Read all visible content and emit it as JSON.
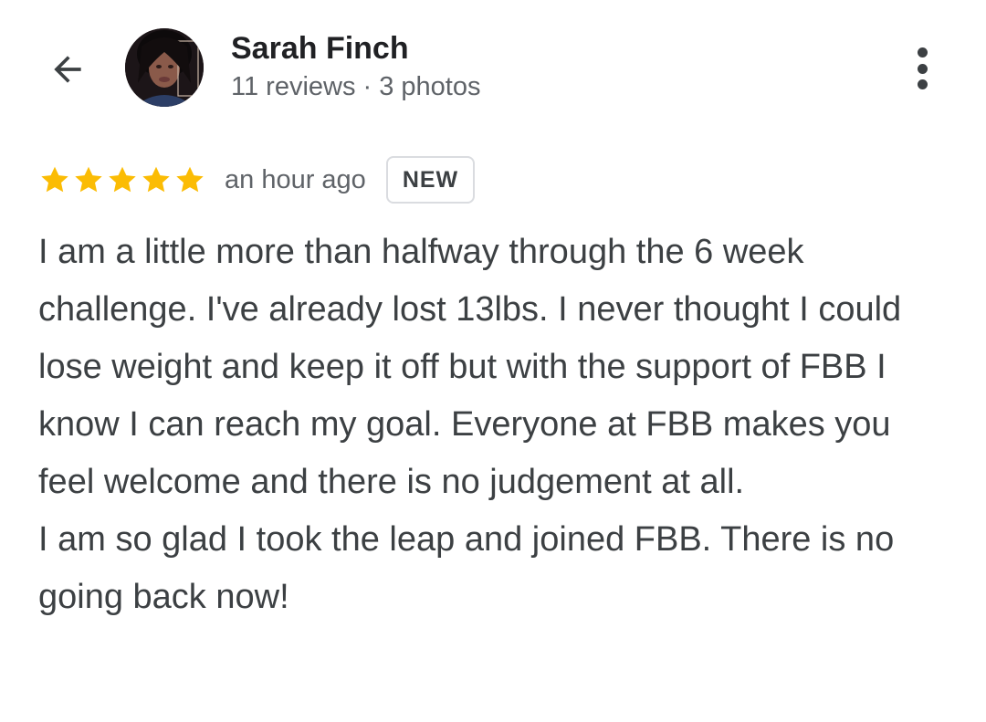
{
  "reviewer": {
    "name": "Sarah Finch",
    "stats": "11 reviews · 3 photos"
  },
  "icons": {
    "back": "arrow-back-icon",
    "more": "more-vert-icon",
    "star": "star-icon"
  },
  "review": {
    "rating": 5,
    "rating_max": 5,
    "time_ago": "an hour ago",
    "badge": "NEW",
    "text": "I am a little more than halfway through the 6 week challenge. I've already lost 13lbs. I never thought I could lose weight and keep it off but with the support of FBB I know I can reach my goal. Everyone at FBB makes you feel welcome and there is no judgement at all.\nI am so glad I took the leap and joined FBB. There is no going back now!"
  },
  "colors": {
    "star": "#fbbc04",
    "text": "#3c4043",
    "secondary_text": "#5f6368",
    "badge_border": "#dadce0"
  }
}
